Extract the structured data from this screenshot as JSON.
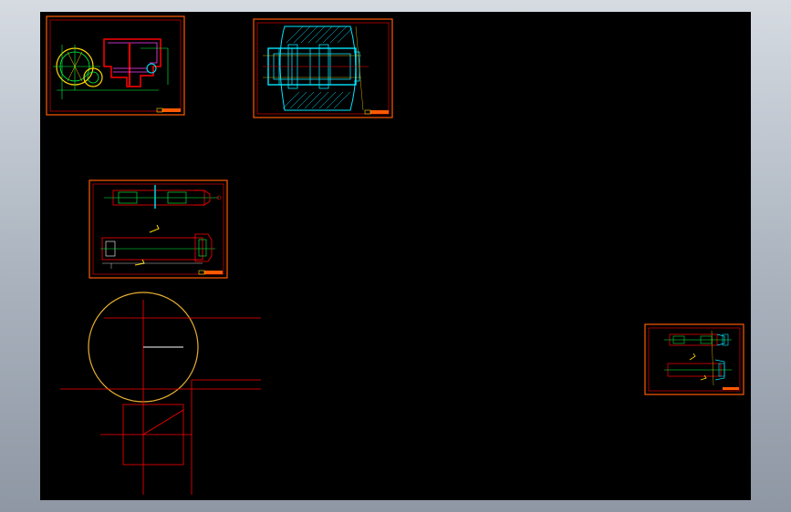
{
  "viewport": {
    "name": "cad-model-space",
    "background": "#000000",
    "frame_color": "#9aa3ae"
  },
  "colors": {
    "orange": "#ff5a00",
    "red": "#ff0000",
    "yellow": "#ffd800",
    "cyan": "#00e5ff",
    "green": "#00ff40",
    "magenta": "#ff40ff",
    "white": "#ffffff",
    "circle": "#e8b030"
  },
  "drawings": [
    {
      "id": "gearbox-assembly",
      "icon": "gear-section-drawing"
    },
    {
      "id": "shaft-cross-section",
      "icon": "hatched-section-drawing"
    },
    {
      "id": "shaft-detail",
      "icon": "shaft-elevation-drawing"
    },
    {
      "id": "small-shaft-sheet",
      "icon": "shaft-elevation-drawing"
    }
  ],
  "construction": {
    "icon": "circle-construction-geometry"
  }
}
